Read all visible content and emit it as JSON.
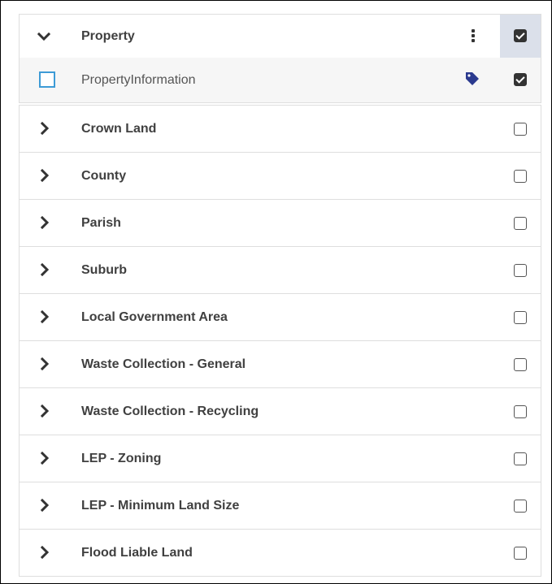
{
  "group": {
    "title": "Property",
    "checked": true,
    "expanded": true,
    "child": {
      "label": "PropertyInformation",
      "checked": true,
      "icon": "tag-icon"
    }
  },
  "layers": [
    {
      "label": "Crown Land",
      "checked": false
    },
    {
      "label": "County",
      "checked": false
    },
    {
      "label": "Parish",
      "checked": false
    },
    {
      "label": "Suburb",
      "checked": false
    },
    {
      "label": "Local Government Area",
      "checked": false
    },
    {
      "label": "Waste Collection - General",
      "checked": false
    },
    {
      "label": "Waste Collection - Recycling",
      "checked": false
    },
    {
      "label": "LEP - Zoning",
      "checked": false
    },
    {
      "label": "LEP - Minimum Land Size",
      "checked": false
    },
    {
      "label": "Flood Liable Land",
      "checked": false
    }
  ],
  "colors": {
    "text": "#404040",
    "child_text": "#555555",
    "header_check_bg": "#dbe0ea",
    "child_row_bg": "#f6f6f6",
    "tag_icon": "#2b3a8f",
    "child_square_border": "#3d9bd6",
    "row_border": "#dedede"
  }
}
